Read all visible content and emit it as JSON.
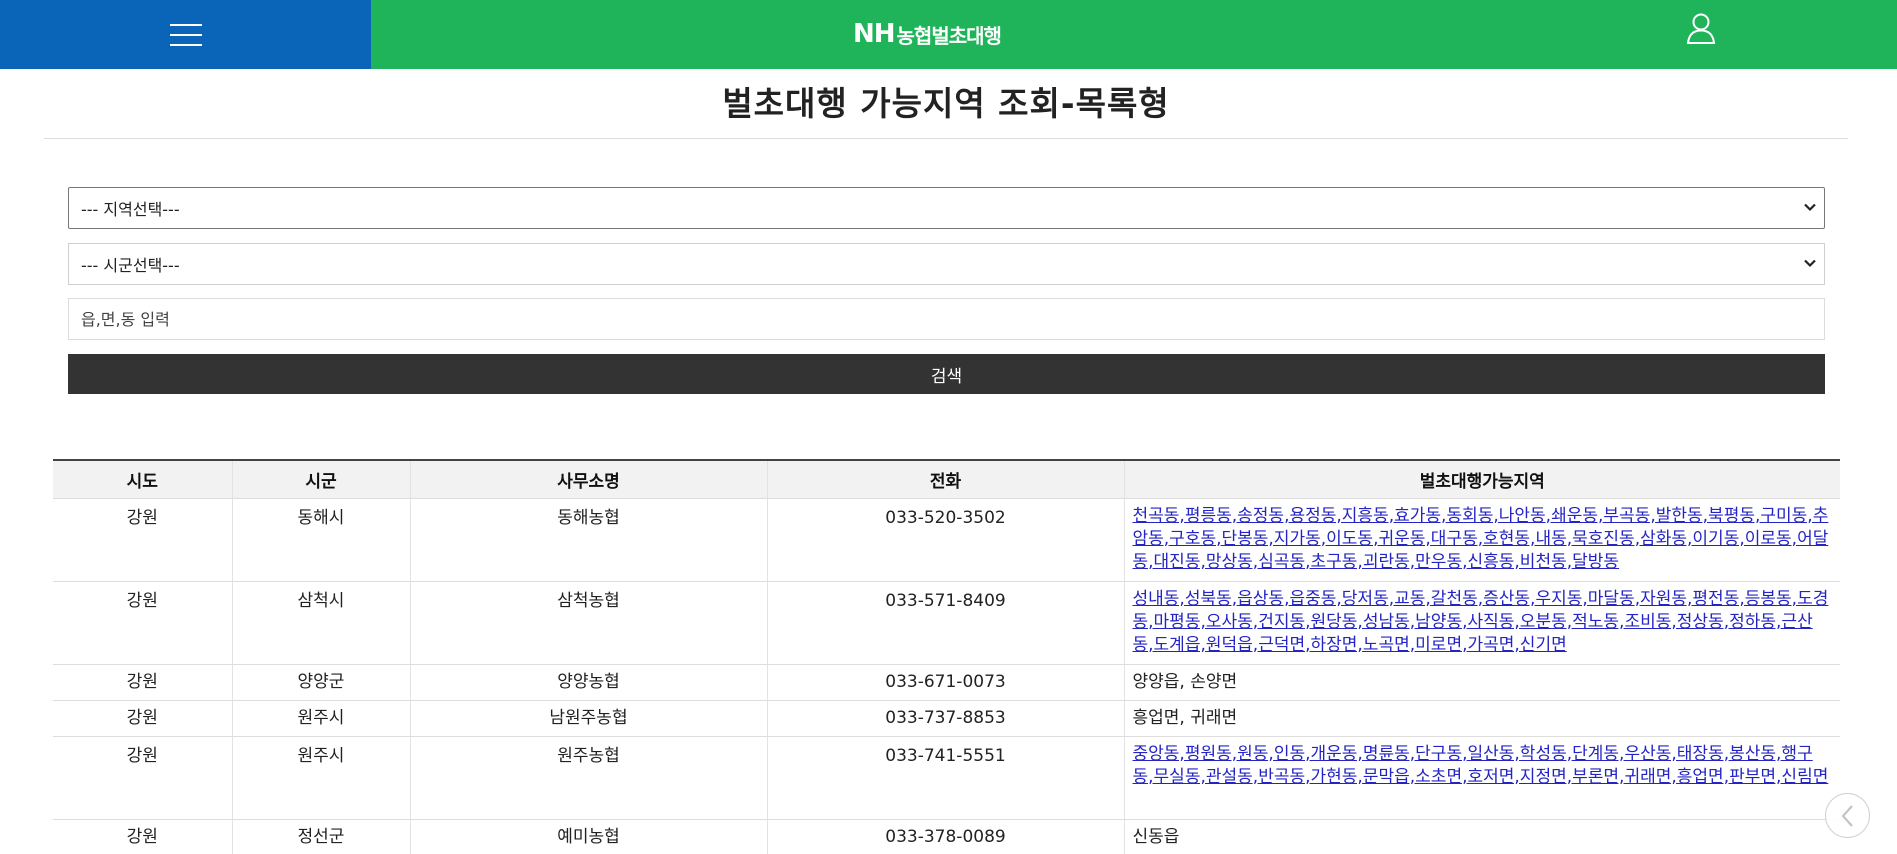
{
  "header": {
    "brand_nh": "NH",
    "brand_name": "농협벌초대행"
  },
  "page": {
    "title": "벌초대행 가능지역 조회-목록형"
  },
  "search": {
    "region_select_value": "--- 지역선택---",
    "city_select_value": "--- 시군선택---",
    "town_input_placeholder": "읍,면,동 입력",
    "search_button_label": "검색"
  },
  "table": {
    "headers": [
      "시도",
      "시군",
      "사무소명",
      "전화",
      "벌초대행가능지역"
    ],
    "rows": [
      {
        "sido": "강원",
        "sigun": "동해시",
        "office": "동해농협",
        "phone": "033-520-3502",
        "areas_linked": true,
        "areas": "천곡동,평릉동,송정동,용정동,지흥동,효가동,동회동,나안동,쇄운동,부곡동,발한동,북평동,구미동,추암동,구호동,단봉동,지가동,이도동,귀운동,대구동,호현동,내동,묵호진동,삼화동,이기동,이로동,어달동,대진동,망상동,심곡동,초구동,괴란동,만우동,신흥동,비천동,달방동"
      },
      {
        "sido": "강원",
        "sigun": "삼척시",
        "office": "삼척농협",
        "phone": "033-571-8409",
        "areas_linked": true,
        "areas": "성내동,성북동,읍상동,읍중동,당저동,교동,갈천동,증산동,우지동,마달동,자원동,평전동,등봉동,도경동,마평동,오사동,건지동,원당동,성남동,남양동,사직동,오분동,적노동,조비동,정상동,정하동,근산동,도계읍,원덕읍,근덕면,하장면,노곡면,미로면,가곡면,신기면"
      },
      {
        "sido": "강원",
        "sigun": "양양군",
        "office": "양양농협",
        "phone": "033-671-0073",
        "areas_linked": false,
        "areas": "양양읍, 손양면"
      },
      {
        "sido": "강원",
        "sigun": "원주시",
        "office": "남원주농협",
        "phone": "033-737-8853",
        "areas_linked": false,
        "areas": "흥업면, 귀래면"
      },
      {
        "sido": "강원",
        "sigun": "원주시",
        "office": "원주농협",
        "phone": "033-741-5551",
        "areas_linked": true,
        "areas": "중앙동,평원동,원동,인동,개운동,명륜동,단구동,일산동,학성동,단계동,우산동,태장동,봉산동,행구동,무실동,관설동,반곡동,가현동,문막읍,소초면,호저면,지정면,부론면,귀래면,흥업면,판부면,신림면"
      },
      {
        "sido": "강원",
        "sigun": "정선군",
        "office": "예미농협",
        "phone": "033-378-0089",
        "areas_linked": false,
        "areas": "신동읍"
      }
    ]
  }
}
